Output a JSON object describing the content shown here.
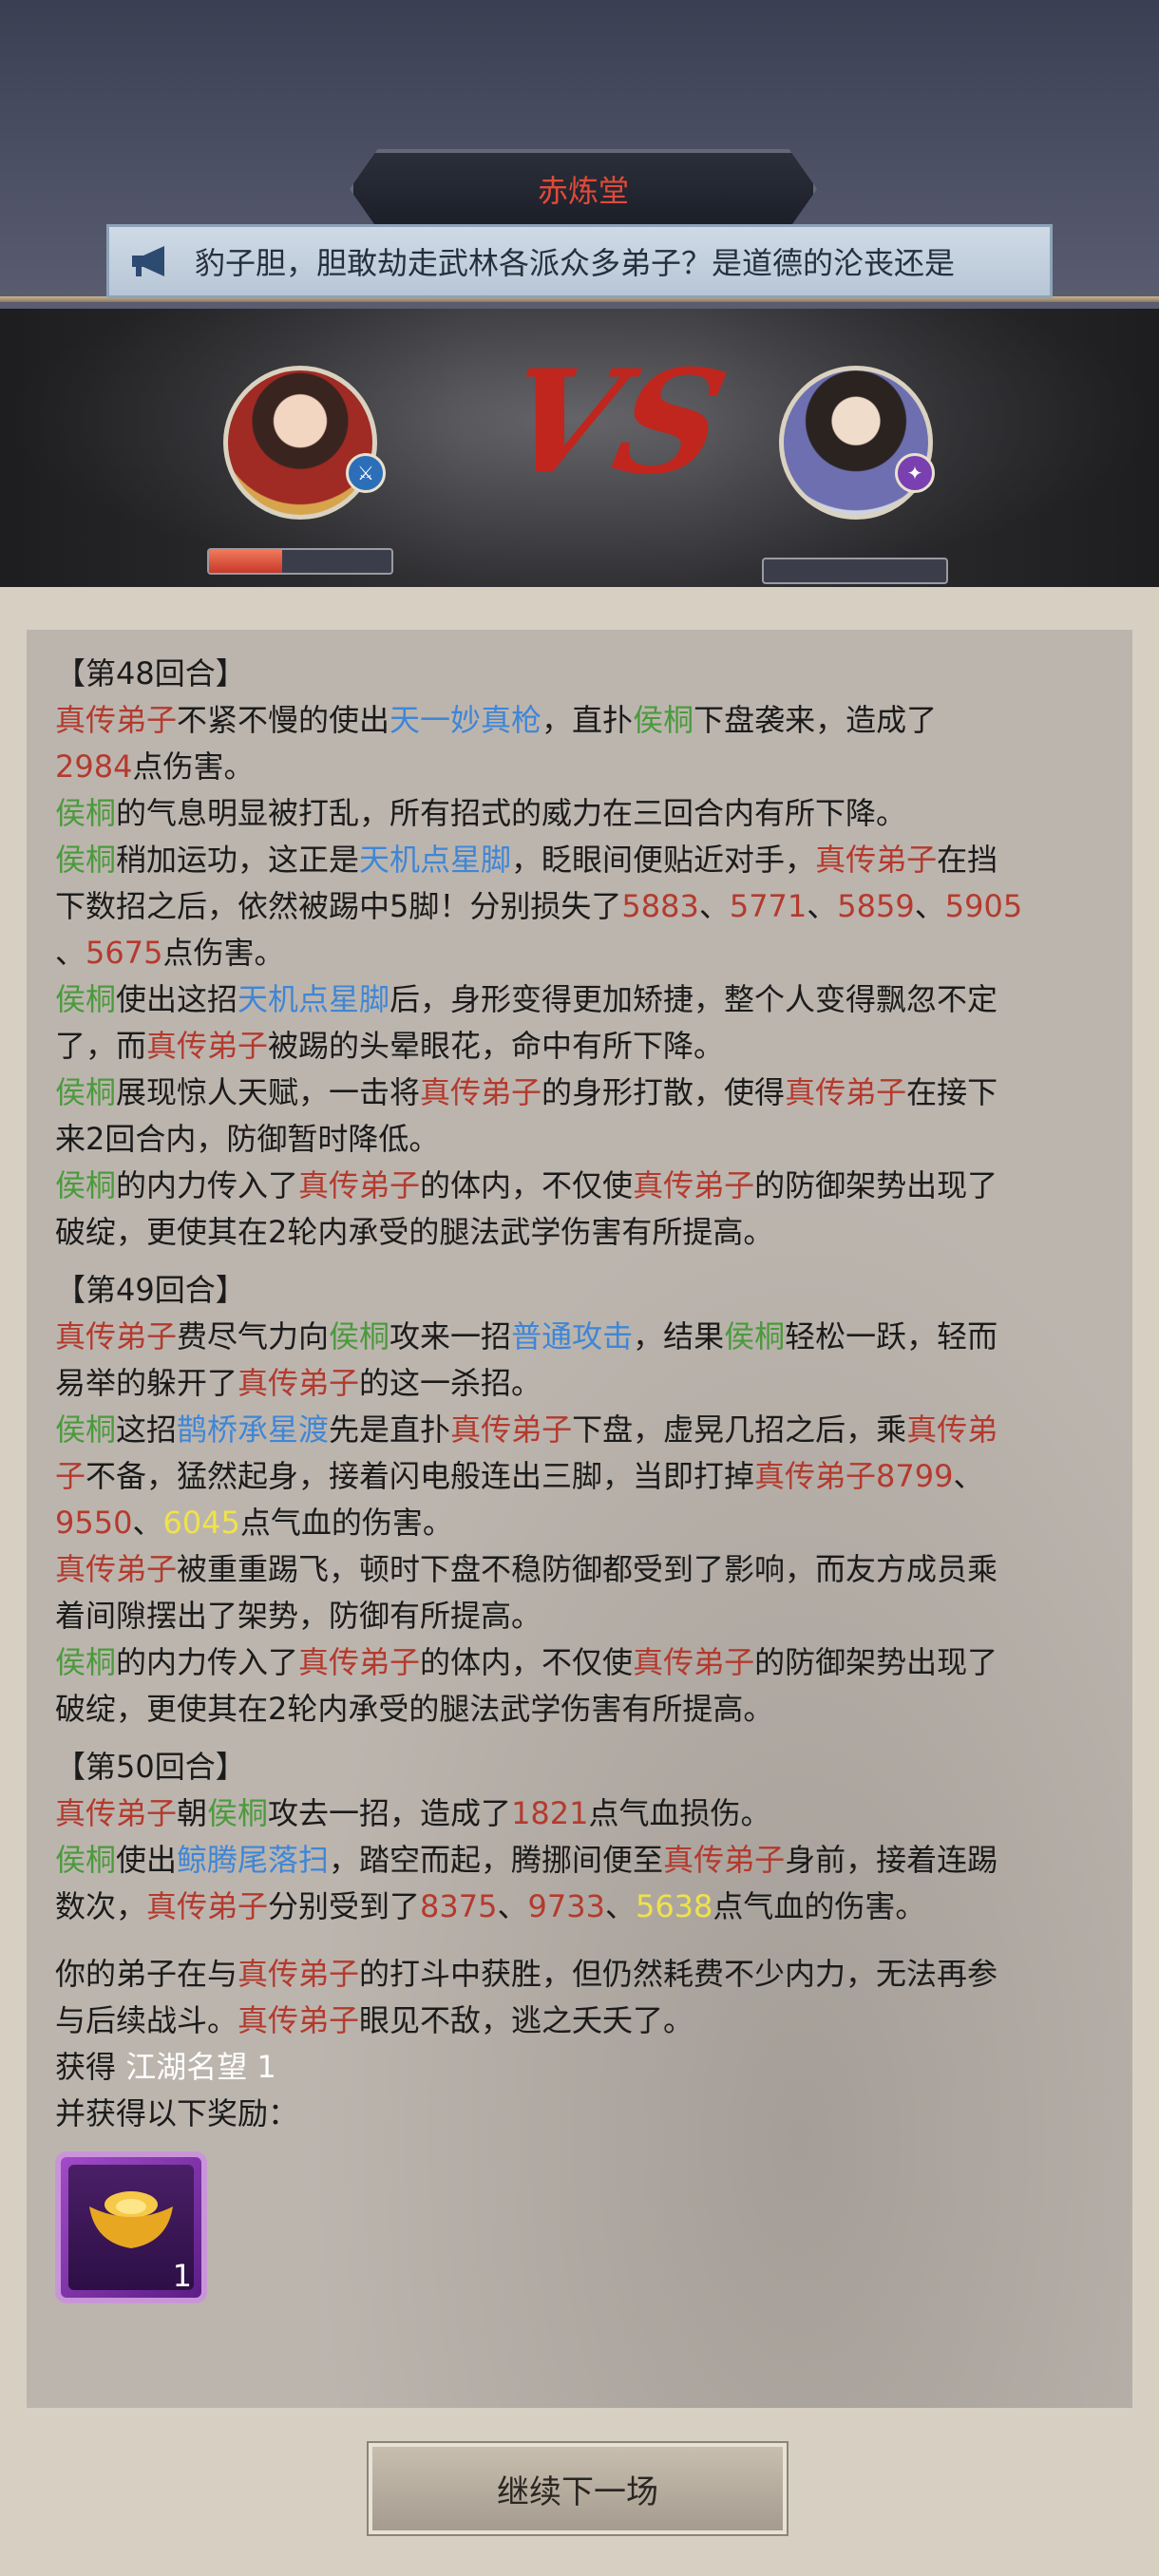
{
  "header": {
    "title": "赤炼堂",
    "notice": "豹子胆，胆敢劫走武林各派众多弟子？是道德的沦丧还是"
  },
  "battle": {
    "left_hp_fraction": 0.4,
    "right_hp_fraction": 0.0,
    "vs_text": "VS"
  },
  "colors": {
    "enemy": "#b43a2e",
    "ally": "#4b9a3c",
    "skill": "#3f86d6",
    "crit": "#f0e24a"
  },
  "log": {
    "round48": "【第48回合】",
    "r48_l1": [
      "真传弟子",
      "不紧不慢的使出",
      "天一妙真枪",
      "，直扑",
      "侯桐",
      "下盘袭来，造成了"
    ],
    "r48_l2": [
      "2984",
      "点伤害。"
    ],
    "r48_l3": [
      "侯桐",
      "的气息明显被打乱，所有招式的威力在三回合内有所下降。"
    ],
    "r48_l4": [
      "侯桐",
      "稍加运功，这正是",
      "天机点星脚",
      "，眨眼间便贴近对手，",
      "真传弟子",
      "在挡"
    ],
    "r48_l5": [
      "下数招之后，依然被踢中5脚！分别损失了",
      "5883",
      "、",
      "5771",
      "、",
      "5859",
      "、",
      "5905"
    ],
    "r48_l6": [
      "、",
      "5675",
      "点伤害。"
    ],
    "r48_l7": [
      "侯桐",
      "使出这招",
      "天机点星脚",
      "后，身形变得更加矫捷，整个人变得飘忽不定"
    ],
    "r48_l8": [
      "了，而",
      "真传弟子",
      "被踢的头晕眼花，命中有所下降。"
    ],
    "r48_l9": [
      "侯桐",
      "展现惊人天赋，一击将",
      "真传弟子",
      "的身形打散，使得",
      "真传弟子",
      "在接下"
    ],
    "r48_l10": [
      "来2回合内，防御暂时降低。"
    ],
    "r48_l11": [
      "侯桐",
      "的内力传入了",
      "真传弟子",
      "的体内，不仅使",
      "真传弟子",
      "的防御架势出现了"
    ],
    "r48_l12": [
      "破绽，更使其在2轮内承受的腿法武学伤害有所提高。"
    ],
    "round49": "【第49回合】",
    "r49_l1": [
      "真传弟子",
      "费尽气力向",
      "侯桐",
      "攻来一招",
      "普通攻击",
      "，结果",
      "侯桐",
      "轻松一跃，轻而"
    ],
    "r49_l2": [
      "易举的躲开了",
      "真传弟子",
      "的这一杀招。"
    ],
    "r49_l3": [
      "侯桐",
      "这招",
      "鹊桥承星渡",
      "先是直扑",
      "真传弟子",
      "下盘，虚晃几招之后，乘",
      "真传弟"
    ],
    "r49_l4": [
      "子",
      "不备，猛然起身，接着闪电般连出三脚，当即打掉",
      "真传弟子",
      "8799",
      "、"
    ],
    "r49_l5": [
      "9550",
      "、",
      "6045",
      "点气血的伤害。"
    ],
    "r49_l6": [
      "真传弟子",
      "被重重踢飞，顿时下盘不稳防御都受到了影响，而友方成员乘"
    ],
    "r49_l7": [
      "着间隙摆出了架势，防御有所提高。"
    ],
    "r49_l8": [
      "侯桐",
      "的内力传入了",
      "真传弟子",
      "的体内，不仅使",
      "真传弟子",
      "的防御架势出现了"
    ],
    "r49_l9": [
      "破绽，更使其在2轮内承受的腿法武学伤害有所提高。"
    ],
    "round50": "【第50回合】",
    "r50_l1": [
      "真传弟子",
      "朝",
      "侯桐",
      "攻去一招，造成了",
      "1821",
      "点气血损伤。"
    ],
    "r50_l2": [
      "侯桐",
      "使出",
      "鲸腾尾落扫",
      "，踏空而起，腾挪间便至",
      "真传弟子",
      "身前，接着连踢"
    ],
    "r50_l3": [
      "数次，",
      "真传弟子",
      "分别受到了",
      "8375",
      "、",
      "9733",
      "、",
      "5638",
      "点气血的伤害。"
    ],
    "end_l1": [
      "你的弟子在与",
      "真传弟子",
      "的打斗中获胜，但仍然耗费不少内力，无法再参"
    ],
    "end_l2": [
      "与后续战斗。",
      "真传弟子",
      "眼见不敌，逃之夭夭了。"
    ],
    "gain_label": "获得",
    "gain_value": "江湖名望 1",
    "reward_label": "并获得以下奖励："
  },
  "reward": {
    "icon": "gold-ingot-icon",
    "count": "1"
  },
  "continue_label": "继续下一场"
}
